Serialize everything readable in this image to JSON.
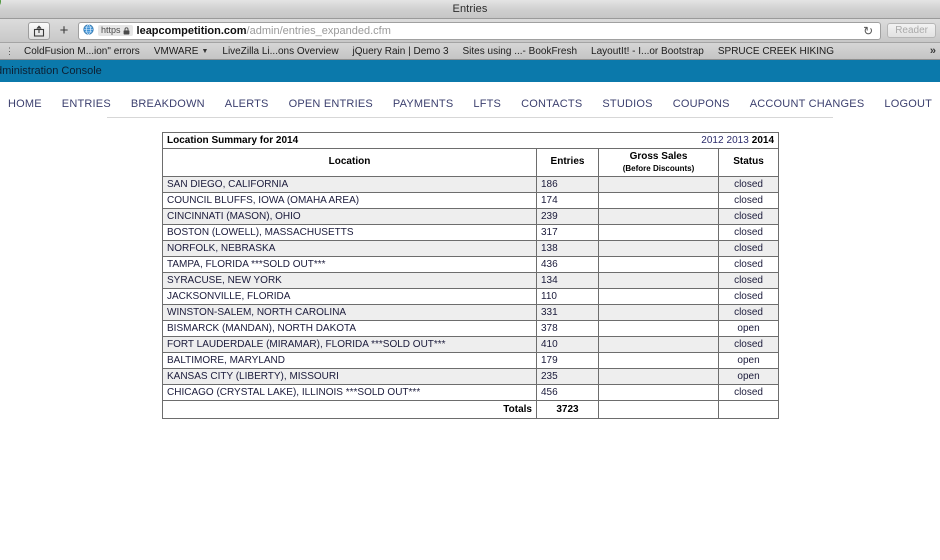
{
  "window": {
    "title": "Entries",
    "traffic_light": "green"
  },
  "toolbar": {
    "share_icon": "share-icon",
    "new_tab_icon": "plus-icon",
    "site_icon": "globe-icon",
    "scheme_label": "https",
    "lock_icon": "lock-icon",
    "url_domain": "leapcompetition.com",
    "url_path": "/admin/entries_expanded.cfm",
    "reload_icon": "reload-icon",
    "reader_label": "Reader"
  },
  "bookmarks": {
    "grip_icon": "drag-grip-icon",
    "overflow_icon": "chevron-double-right-icon",
    "items": [
      {
        "label": "ColdFusion M...ion\" errors",
        "has_caret": false
      },
      {
        "label": "VMWARE",
        "has_caret": true
      },
      {
        "label": "LiveZilla Li...ons Overview",
        "has_caret": false
      },
      {
        "label": "jQuery Rain | Demo 3",
        "has_caret": false
      },
      {
        "label": "Sites using ...- BookFresh",
        "has_caret": false
      },
      {
        "label": "LayoutIt! - I...or Bootstrap",
        "has_caret": false
      },
      {
        "label": "SPRUCE CREEK HIKING",
        "has_caret": false
      }
    ]
  },
  "app": {
    "header_title": "dministration Console",
    "header_color": "#0b79ab",
    "nav": [
      "HOME",
      "ENTRIES",
      "BREAKDOWN",
      "ALERTS",
      "OPEN ENTRIES",
      "PAYMENTS",
      "LFTS",
      "CONTACTS",
      "STUDIOS",
      "COUPONS",
      "ACCOUNT CHANGES",
      "LOGOUT"
    ]
  },
  "report": {
    "summary_title": "Location Summary for 2014",
    "years": [
      {
        "label": "2012",
        "current": false
      },
      {
        "label": "2013",
        "current": false
      },
      {
        "label": "2014",
        "current": true
      }
    ],
    "columns": {
      "location": "Location",
      "entries": "Entries",
      "gross_sales": "Gross Sales",
      "gross_sales_sub": "(Before Discounts)",
      "status": "Status"
    },
    "rows": [
      {
        "location": "SAN DIEGO, CALIFORNIA",
        "entries": "186",
        "gross": "",
        "status": "closed"
      },
      {
        "location": "COUNCIL BLUFFS, IOWA (OMAHA AREA)",
        "entries": "174",
        "gross": "",
        "status": "closed"
      },
      {
        "location": "CINCINNATI (MASON), OHIO",
        "entries": "239",
        "gross": "",
        "status": "closed"
      },
      {
        "location": "BOSTON (LOWELL), MASSACHUSETTS",
        "entries": "317",
        "gross": "",
        "status": "closed"
      },
      {
        "location": "NORFOLK, NEBRASKA",
        "entries": "138",
        "gross": "",
        "status": "closed"
      },
      {
        "location": "TAMPA, FLORIDA ***SOLD OUT***",
        "entries": "436",
        "gross": "",
        "status": "closed"
      },
      {
        "location": "SYRACUSE, NEW YORK",
        "entries": "134",
        "gross": "",
        "status": "closed"
      },
      {
        "location": "JACKSONVILLE, FLORIDA",
        "entries": "110",
        "gross": "",
        "status": "closed"
      },
      {
        "location": "WINSTON-SALEM, NORTH CAROLINA",
        "entries": "331",
        "gross": "",
        "status": "closed"
      },
      {
        "location": "BISMARCK (MANDAN), NORTH DAKOTA",
        "entries": "378",
        "gross": "",
        "status": "open"
      },
      {
        "location": "FORT LAUDERDALE (MIRAMAR), FLORIDA ***SOLD OUT***",
        "entries": "410",
        "gross": "",
        "status": "closed"
      },
      {
        "location": "BALTIMORE, MARYLAND",
        "entries": "179",
        "gross": "",
        "status": "open"
      },
      {
        "location": "KANSAS CITY (LIBERTY), MISSOURI",
        "entries": "235",
        "gross": "",
        "status": "open"
      },
      {
        "location": "CHICAGO (CRYSTAL LAKE), ILLINOIS ***SOLD OUT***",
        "entries": "456",
        "gross": "",
        "status": "closed"
      }
    ],
    "totals": {
      "label": "Totals",
      "entries": "3723",
      "gross": "",
      "status": ""
    }
  }
}
